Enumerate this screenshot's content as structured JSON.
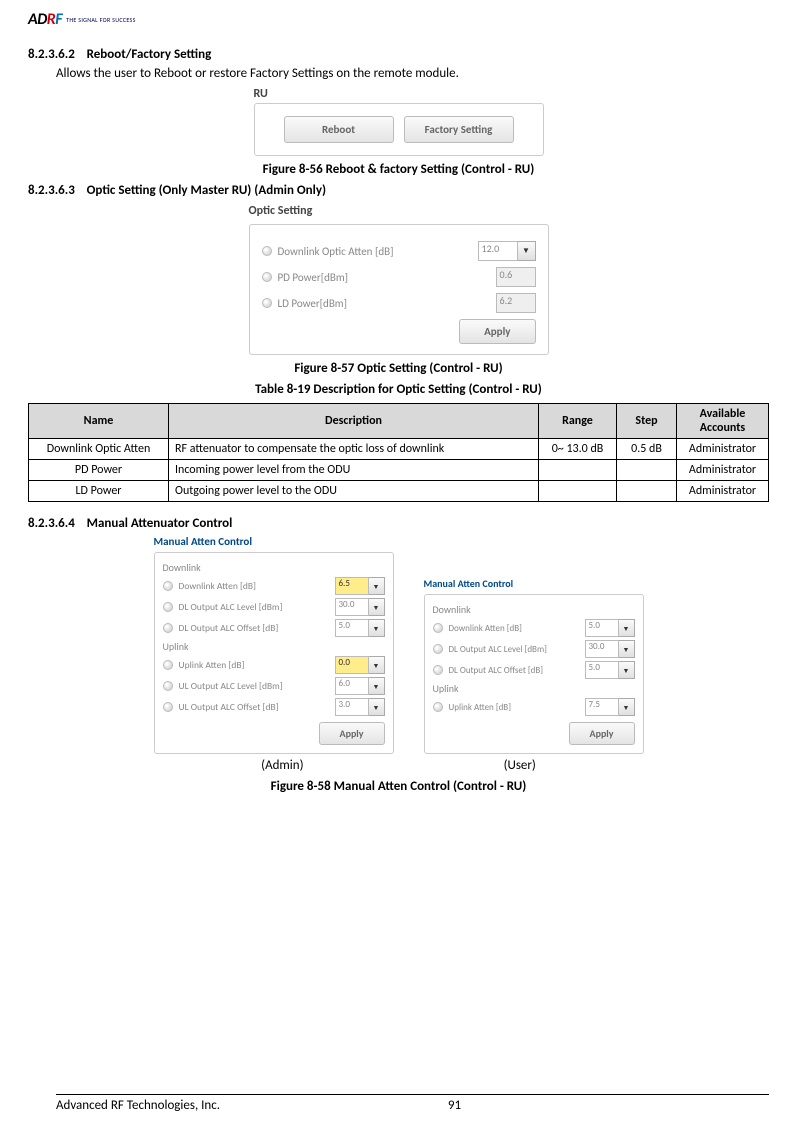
{
  "logo": {
    "text_a": "AD",
    "text_r": "R",
    "text_f": "F",
    "tagline": "THE SIGNAL FOR SUCCESS"
  },
  "s1": {
    "num": "8.2.3.6.2",
    "title": "Reboot/Factory Setting",
    "desc": "Allows the user to Reboot or restore Factory Settings on the remote module.",
    "panel_title": "RU",
    "btn_reboot": "Reboot",
    "btn_factory": "Factory Setting",
    "caption": "Figure 8-56    Reboot & factory Setting (Control - RU)"
  },
  "s2": {
    "num": "8.2.3.6.3",
    "title": "Optic Setting (Only Master RU) (Admin Only)",
    "panel_title": "Optic Setting",
    "rows": [
      {
        "label": "Downlink Optic  Atten  [dB]",
        "value": "12.0",
        "dd": true
      },
      {
        "label": "PD Power[dBm]",
        "value": "0.6",
        "dd": false
      },
      {
        "label": "LD Power[dBm]",
        "value": "6.2",
        "dd": false
      }
    ],
    "apply": "Apply",
    "caption": "Figure 8-57    Optic Setting (Control - RU)"
  },
  "table": {
    "caption": "Table 8-19     Description for Optic Setting (Control - RU)",
    "headers": [
      "Name",
      "Description",
      "Range",
      "Step",
      "Available Accounts"
    ],
    "rows": [
      {
        "name": "Downlink Optic Atten",
        "desc": "RF attenuator to compensate the optic loss of downlink",
        "range": "0~ 13.0 dB",
        "step": "0.5 dB",
        "acct": "Administrator"
      },
      {
        "name": "PD Power",
        "desc": "Incoming power level from the ODU",
        "range": "",
        "step": "",
        "acct": "Administrator"
      },
      {
        "name": "LD Power",
        "desc": "Outgoing power level to the ODU",
        "range": "",
        "step": "",
        "acct": "Administrator"
      }
    ]
  },
  "s3": {
    "num": "8.2.3.6.4",
    "title": "Manual Attenuator Control",
    "panel_title": "Manual Atten Control",
    "admin": {
      "downlink_header": "Downlink",
      "uplink_header": "Uplink",
      "rows_dl": [
        {
          "label": "Downlink Atten [dB]",
          "value": "6.5",
          "hl": true
        },
        {
          "label": "DL Output ALC Level [dBm]",
          "value": "30.0",
          "hl": false
        },
        {
          "label": "DL Output ALC Offset [dB]",
          "value": "5.0",
          "hl": false
        }
      ],
      "rows_ul": [
        {
          "label": "Uplink Atten [dB]",
          "value": "0.0",
          "hl": true
        },
        {
          "label": "UL Output ALC Level [dBm]",
          "value": "6.0",
          "hl": false
        },
        {
          "label": "UL Output ALC Offset [dB]",
          "value": "3.0",
          "hl": false
        }
      ],
      "apply": "Apply",
      "role": "(Admin)"
    },
    "user": {
      "downlink_header": "Downlink",
      "uplink_header": "Uplink",
      "rows_dl": [
        {
          "label": "Downlink Atten [dB]",
          "value": "5.0",
          "hl": false
        },
        {
          "label": "DL Output ALC Level [dBm]",
          "value": "30.0",
          "hl": false
        },
        {
          "label": "DL Output ALC Offset [dB]",
          "value": "5.0",
          "hl": false
        }
      ],
      "rows_ul": [
        {
          "label": "Uplink Atten [dB]",
          "value": "7.5",
          "hl": false
        }
      ],
      "apply": "Apply",
      "role": "(User)"
    },
    "caption": "Figure 8-58    Manual Atten Control (Control - RU)"
  },
  "footer": {
    "company": "Advanced RF Technologies, Inc.",
    "page": "91"
  }
}
